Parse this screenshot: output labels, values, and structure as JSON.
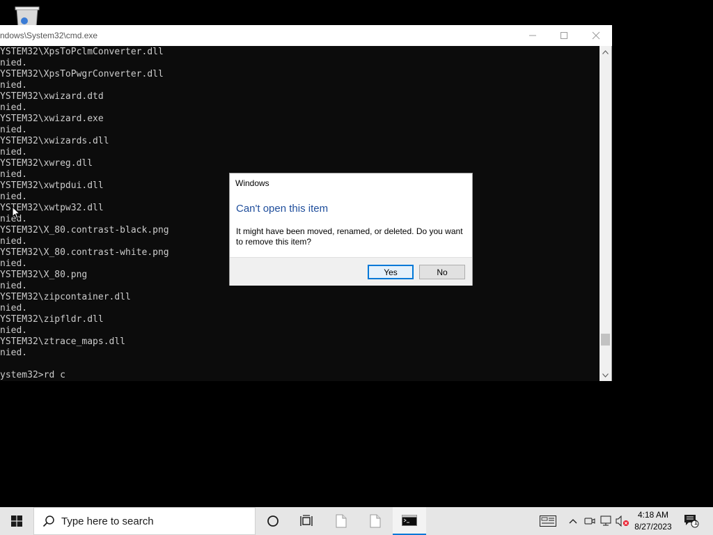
{
  "desktop": {
    "recycle_bin_icon": "recycle-bin-icon"
  },
  "cmd": {
    "title": "ndows\\System32\\cmd.exe",
    "lines": [
      "YSTEM32\\XpsToPclmConverter.dll",
      "nied.",
      "YSTEM32\\XpsToPwgrConverter.dll",
      "nied.",
      "YSTEM32\\xwizard.dtd",
      "nied.",
      "YSTEM32\\xwizard.exe",
      "nied.",
      "YSTEM32\\xwizards.dll",
      "nied.",
      "YSTEM32\\xwreg.dll",
      "nied.",
      "YSTEM32\\xwtpdui.dll",
      "nied.",
      "YSTEM32\\xwtpw32.dll",
      "nied.",
      "YSTEM32\\X_80.contrast-black.png",
      "nied.",
      "YSTEM32\\X_80.contrast-white.png",
      "nied.",
      "YSTEM32\\X_80.png",
      "nied.",
      "YSTEM32\\zipcontainer.dll",
      "nied.",
      "YSTEM32\\zipfldr.dll",
      "nied.",
      "YSTEM32\\ztrace_maps.dll",
      "nied.",
      "",
      "ystem32>rd c"
    ],
    "background_color": "#0c0c0c",
    "text_color": "#cccccc"
  },
  "dialog": {
    "title": "Windows",
    "heading": "Can't open this item",
    "message": "It might have been moved, renamed, or deleted. Do you want to remove this item?",
    "yes_label": "Yes",
    "no_label": "No",
    "heading_color": "#1f4e9c",
    "accent_color": "#0078d7"
  },
  "taskbar": {
    "search_placeholder": "Type here to search",
    "clock_time": "4:18 AM",
    "clock_date": "8/27/2023",
    "notification_count": "1",
    "icons": [
      "windows-start-icon",
      "search-icon",
      "cortana-icon",
      "task-view-icon",
      "file-icon",
      "file-icon",
      "cmd-icon",
      "keyboard-icon",
      "chevron-up-icon",
      "meet-now-icon",
      "network-icon",
      "volume-muted-icon",
      "notification-icon"
    ]
  }
}
